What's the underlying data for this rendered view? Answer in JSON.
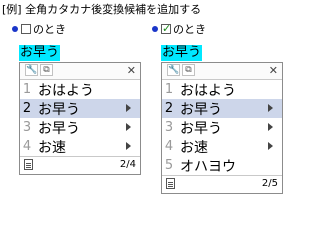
{
  "title": "[例] 全角カタカナ後変換候補を追加する",
  "options": [
    {
      "label": "のとき",
      "checked": false
    },
    {
      "label": "のとき",
      "checked": true
    }
  ],
  "panels": [
    {
      "word": "お早う",
      "candidates": [
        {
          "num": "1",
          "text": "おはよう",
          "submenu": false
        },
        {
          "num": "2",
          "text": "お早う",
          "submenu": true
        },
        {
          "num": "3",
          "text": "お早う",
          "submenu": true
        },
        {
          "num": "4",
          "text": "お速",
          "submenu": true
        }
      ],
      "selected_index": 1,
      "page": "2/4"
    },
    {
      "word": "お早う",
      "candidates": [
        {
          "num": "1",
          "text": "おはよう",
          "submenu": false
        },
        {
          "num": "2",
          "text": "お早う",
          "submenu": true
        },
        {
          "num": "3",
          "text": "お早う",
          "submenu": true
        },
        {
          "num": "4",
          "text": "お速",
          "submenu": true
        },
        {
          "num": "5",
          "text": "オハヨウ",
          "submenu": false
        }
      ],
      "selected_index": 1,
      "page": "2/5"
    }
  ],
  "icons": {
    "option_bullet": "bullet-icon",
    "tool_1": "wrench-icon",
    "tool_2": "copy-icon",
    "close": "close-icon",
    "submenu": "triangle-right-icon",
    "footer": "document-icon"
  },
  "colors": {
    "bullet": "#1a36c9",
    "word_highlight": "#00e8ff",
    "selected_row": "#cdd6ea",
    "check": "#1a8a1a"
  }
}
